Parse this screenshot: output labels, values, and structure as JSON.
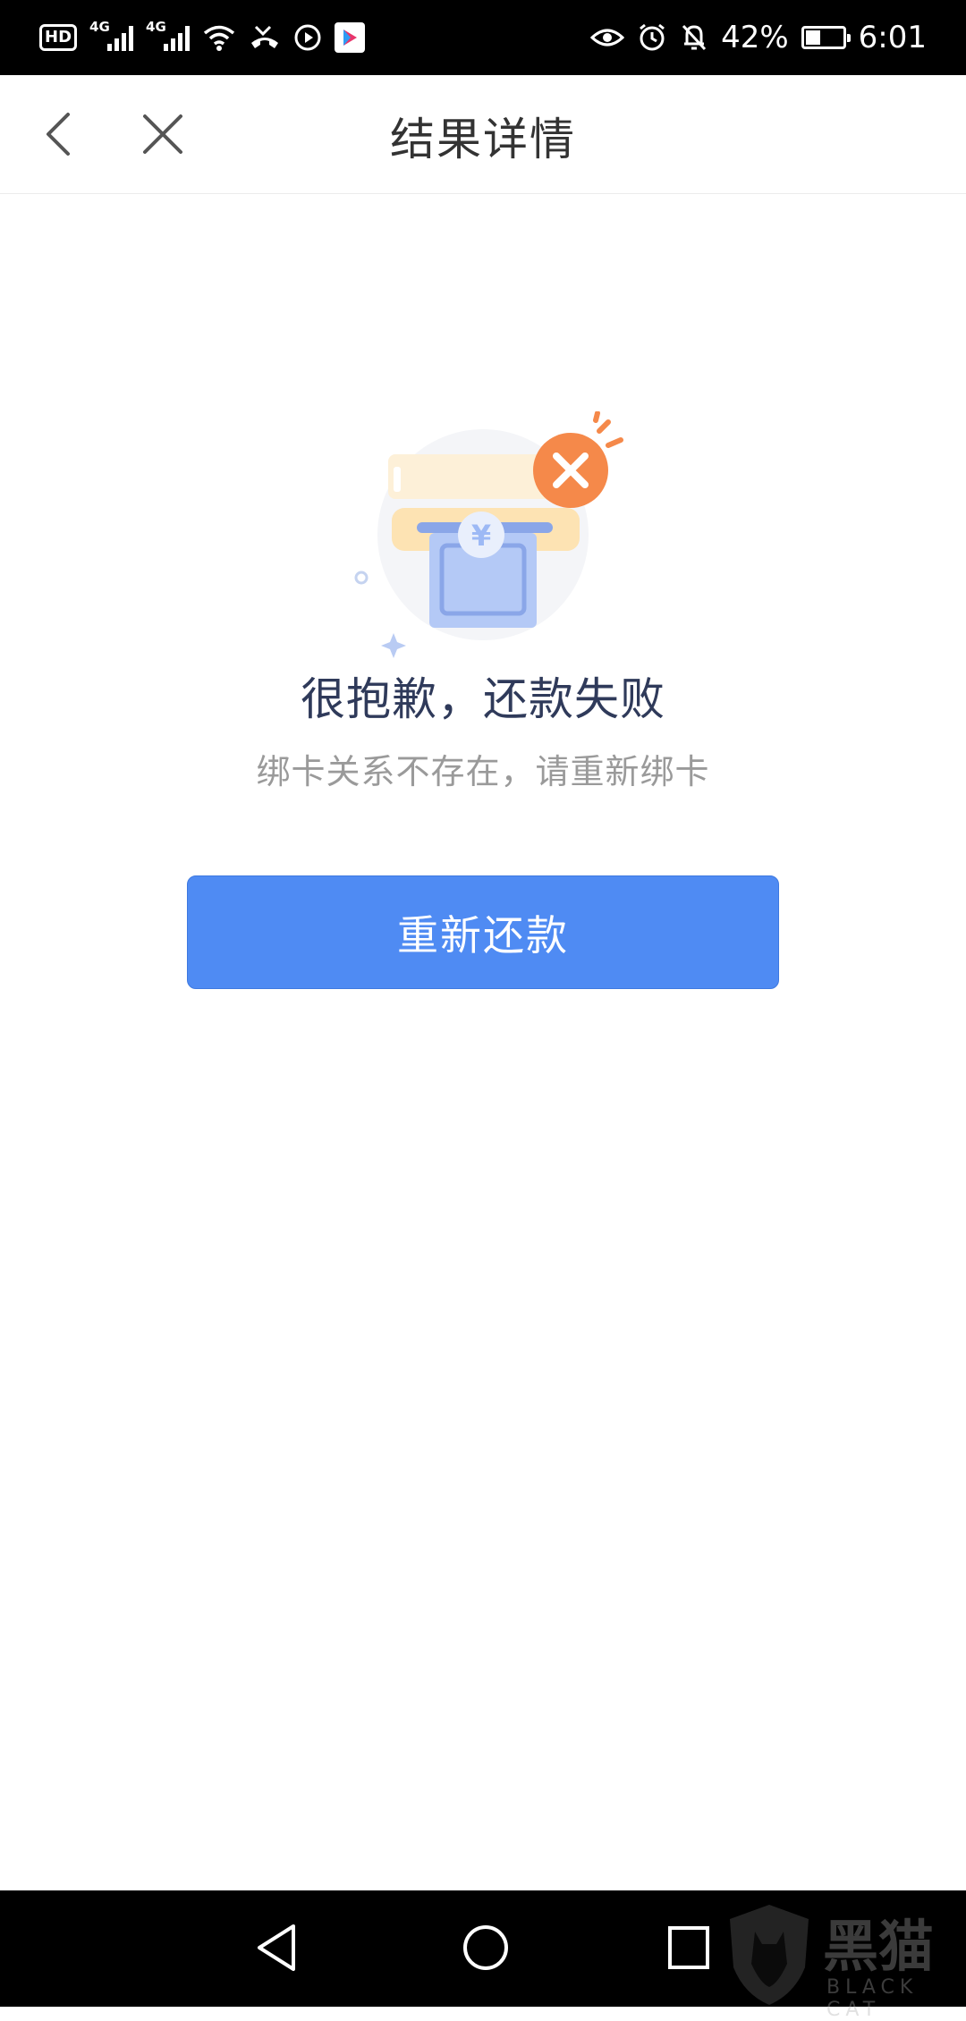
{
  "status_bar": {
    "hd_label": "HD",
    "sim1_label": "4G",
    "sim2_label": "4G",
    "battery_percent": "42%",
    "battery_level": 0.42,
    "time": "6:01",
    "app_icon": "youku-icon"
  },
  "nav": {
    "title": "结果详情",
    "back_icon": "chevron-left-icon",
    "close_icon": "close-icon"
  },
  "result": {
    "title": "很抱歉，还款失败",
    "description": "绑卡关系不存在，请重新绑卡",
    "illustration": "payment-failed-illustration",
    "colors": {
      "error": "#f5894a",
      "card": "#fde8c0",
      "cash": "#9db9f5"
    }
  },
  "actions": {
    "retry_label": "重新还款",
    "retry_color": "#4f8bf3"
  },
  "system_nav": {
    "back_icon": "triangle-back-icon",
    "home_icon": "circle-home-icon",
    "recent_icon": "square-recent-icon"
  },
  "watermark": {
    "text": "黑猫",
    "subtext": "BLACK CAT"
  }
}
